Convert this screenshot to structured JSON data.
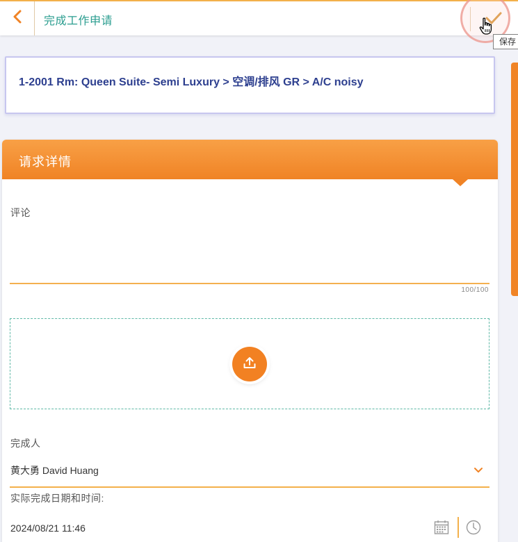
{
  "header": {
    "title": "完成工作申请",
    "save_tooltip": "保存"
  },
  "path": {
    "text": "1-2001 Rm: Queen Suite- Semi Luxury > 空调/排风 GR > A/C noisy"
  },
  "details": {
    "title": "请求详情",
    "comment_label": "评论",
    "comment_value": "",
    "char_count": "100/100",
    "completer_label": "完成人",
    "completer_value": "黄大勇 David Huang",
    "datetime_label": "实际完成日期和时间:",
    "datetime_value": "2024/08/21 11:46"
  },
  "icons": {
    "back": "chevron-left-icon",
    "save": "checkmark-icon",
    "upload": "upload-icon",
    "dropdown": "chevron-down-icon",
    "calendar": "calendar-icon",
    "clock": "clock-icon"
  },
  "colors": {
    "accent_orange": "#f08325",
    "header_title_teal": "#2a9d8f",
    "path_text_blue": "#2d3f8f",
    "field_underline": "#f3b04a"
  }
}
